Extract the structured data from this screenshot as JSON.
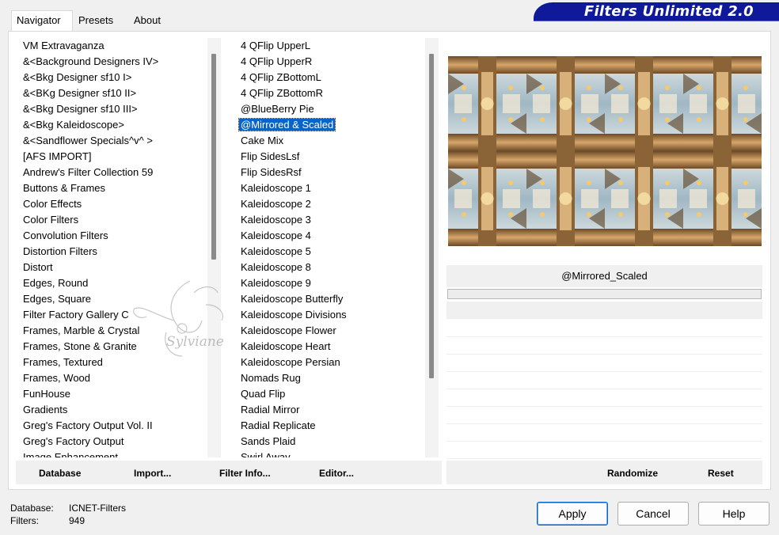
{
  "brand": {
    "title": "Filters Unlimited 2.0"
  },
  "tabs": [
    "Navigator",
    "Presets",
    "About"
  ],
  "categories": [
    "VM Extravaganza",
    "&<Background Designers IV>",
    "&<Bkg Designer sf10 I>",
    "&<BKg Designer sf10 II>",
    "&<Bkg Designer sf10 III>",
    "&<Bkg Kaleidoscope>",
    "&<Sandflower Specials^v^ >",
    "[AFS IMPORT]",
    "Andrew's Filter Collection 59",
    "Buttons & Frames",
    "Color Effects",
    "Color Filters",
    "Convolution Filters",
    "Distortion Filters",
    "Distort",
    "Edges, Round",
    "Edges, Square",
    "Filter Factory Gallery C",
    "Frames, Marble & Crystal",
    "Frames, Stone & Granite",
    "Frames, Textured",
    "Frames, Wood",
    "FunHouse",
    "Gradients",
    "Greg's Factory Output Vol. II",
    "Greg's Factory Output",
    "Image Enhancement"
  ],
  "filters": [
    "4 QFlip UpperL",
    "4 QFlip UpperR",
    "4 QFlip ZBottomL",
    "4 QFlip ZBottomR",
    "@BlueBerry Pie",
    "@Mirrored & Scaled",
    "Cake Mix",
    "Flip SidesLsf",
    "Flip SidesRsf",
    "Kaleidoscope 1",
    "Kaleidoscope 2",
    "Kaleidoscope 3",
    "Kaleidoscope 4",
    "Kaleidoscope 5",
    "Kaleidoscope 8",
    "Kaleidoscope 9",
    "Kaleidoscope Butterfly",
    "Kaleidoscope Divisions",
    "Kaleidoscope Flower",
    "Kaleidoscope Heart",
    "Kaleidoscope Persian",
    "Nomads Rug",
    "Quad Flip",
    "Radial Mirror",
    "Radial Replicate",
    "Sands Plaid",
    "Swirl Away"
  ],
  "selected_filter": "@Mirrored & Scaled",
  "left_buttons": {
    "database": "Database",
    "import": "Import...",
    "filter_info": "Filter Info...",
    "editor": "Editor..."
  },
  "preview": {
    "filter_name": "@Mirrored_Scaled"
  },
  "right_buttons": {
    "randomize": "Randomize",
    "reset": "Reset"
  },
  "info": {
    "database_label": "Database:",
    "database_value": "ICNET-Filters",
    "filters_label": "Filters:",
    "filters_value": "949"
  },
  "dialog_buttons": {
    "apply": "Apply",
    "cancel": "Cancel",
    "help": "Help"
  },
  "watermark": "Sylviane",
  "colors": {
    "brand_bg": "#0e1a9a",
    "selection": "#0a64c8"
  }
}
